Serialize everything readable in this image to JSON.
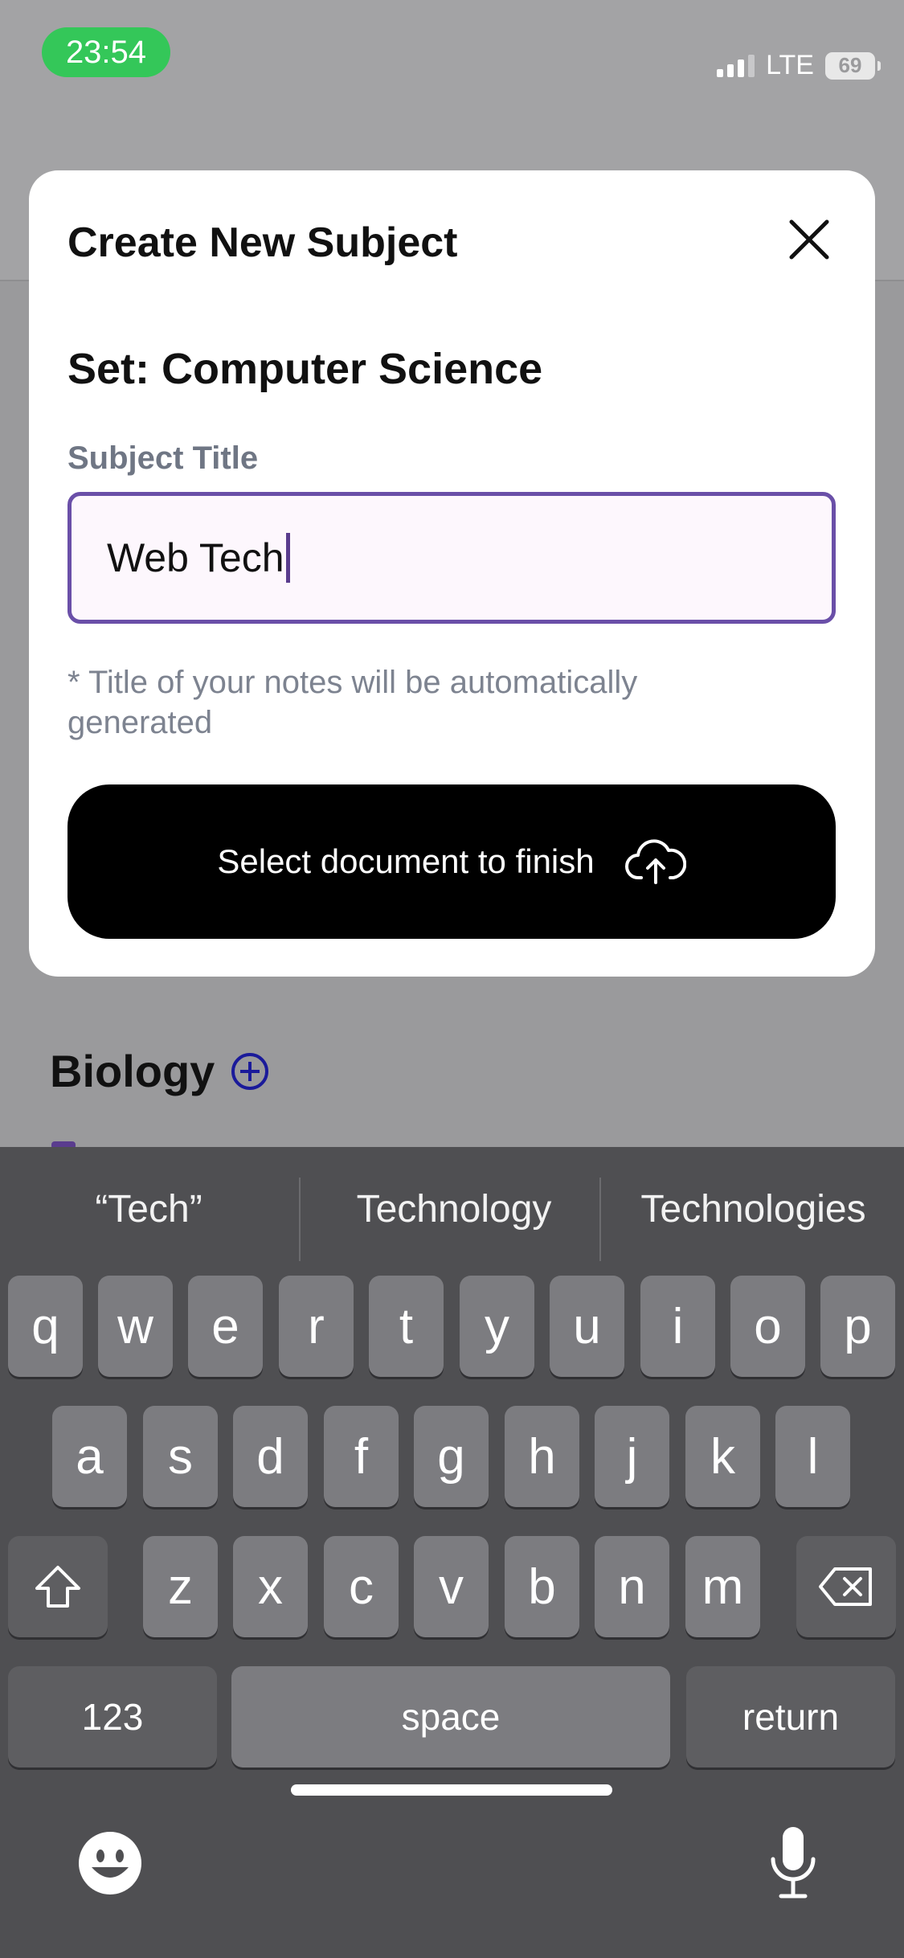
{
  "status_bar": {
    "time": "23:54",
    "network": "LTE",
    "battery": "69"
  },
  "background": {
    "section_title": "Biology"
  },
  "modal": {
    "title": "Create New Subject",
    "set_label": "Set: Computer Science",
    "field_label": "Subject Title",
    "input_value": "Web Tech",
    "hint": "* Title of your notes will be automatically generated",
    "submit_label": "Select document to finish"
  },
  "keyboard": {
    "suggestions": [
      "“Tech”",
      "Technology",
      "Technologies"
    ],
    "row1": [
      "q",
      "w",
      "e",
      "r",
      "t",
      "y",
      "u",
      "i",
      "o",
      "p"
    ],
    "row2": [
      "a",
      "s",
      "d",
      "f",
      "g",
      "h",
      "j",
      "k",
      "l"
    ],
    "row3": [
      "z",
      "x",
      "c",
      "v",
      "b",
      "n",
      "m"
    ],
    "numbers_label": "123",
    "space_label": "space",
    "return_label": "return"
  },
  "icons": [
    "close-icon",
    "cloud-upload-icon",
    "add-circle-icon",
    "shift-icon",
    "backspace-icon",
    "emoji-icon",
    "microphone-icon"
  ]
}
